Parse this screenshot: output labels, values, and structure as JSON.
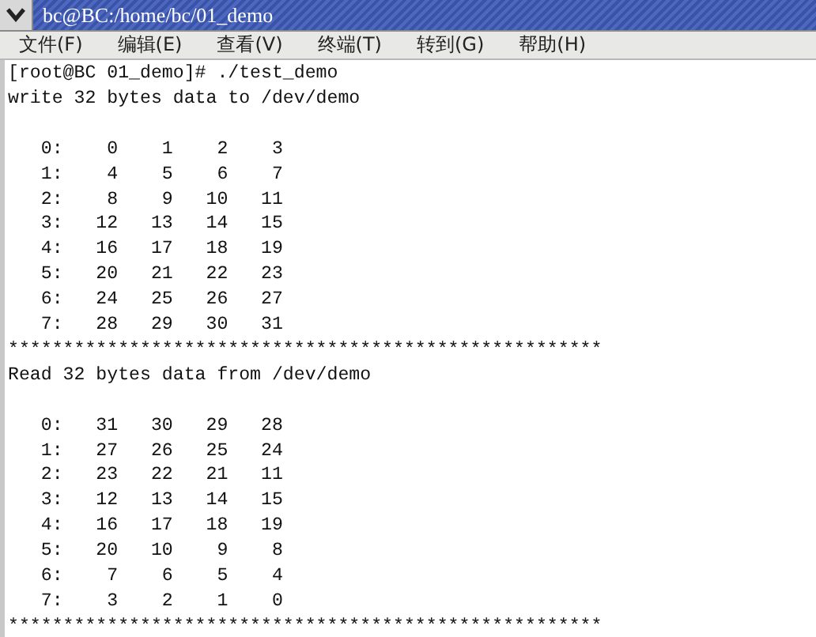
{
  "window": {
    "title": "bc@BC:/home/bc/01_demo"
  },
  "menu": [
    "文件(F)",
    "编辑(E)",
    "查看(V)",
    "终端(T)",
    "转到(G)",
    "帮助(H)"
  ],
  "terminal": {
    "blocks": [
      {
        "kind": "text",
        "lines": [
          "[root@BC 01_demo]# ./test_demo",
          "write 32 bytes data to /dev/demo"
        ]
      },
      {
        "kind": "table",
        "lines": [
          "   0:    0    1    2    3",
          "   1:    4    5    6    7",
          "   2:    8    9   10   11",
          "   3:   12   13   14   15",
          "   4:   16   17   18   19",
          "   5:   20   21   22   23",
          "   6:   24   25   26   27",
          "   7:   28   29   30   31"
        ]
      },
      {
        "kind": "text",
        "lines": [
          "******************************************************",
          "Read 32 bytes data from /dev/demo"
        ]
      },
      {
        "kind": "table",
        "lines": [
          "   0:   31   30   29   28",
          "   1:   27   26   25   24",
          "   2:   23   22   21   11",
          "   3:   12   13   14   15",
          "   4:   16   17   18   19",
          "   5:   20   10    9    8",
          "   6:    7    6    5    4",
          "   7:    3    2    1    0"
        ]
      },
      {
        "kind": "text",
        "lines": [
          "******************************************************"
        ]
      }
    ]
  }
}
